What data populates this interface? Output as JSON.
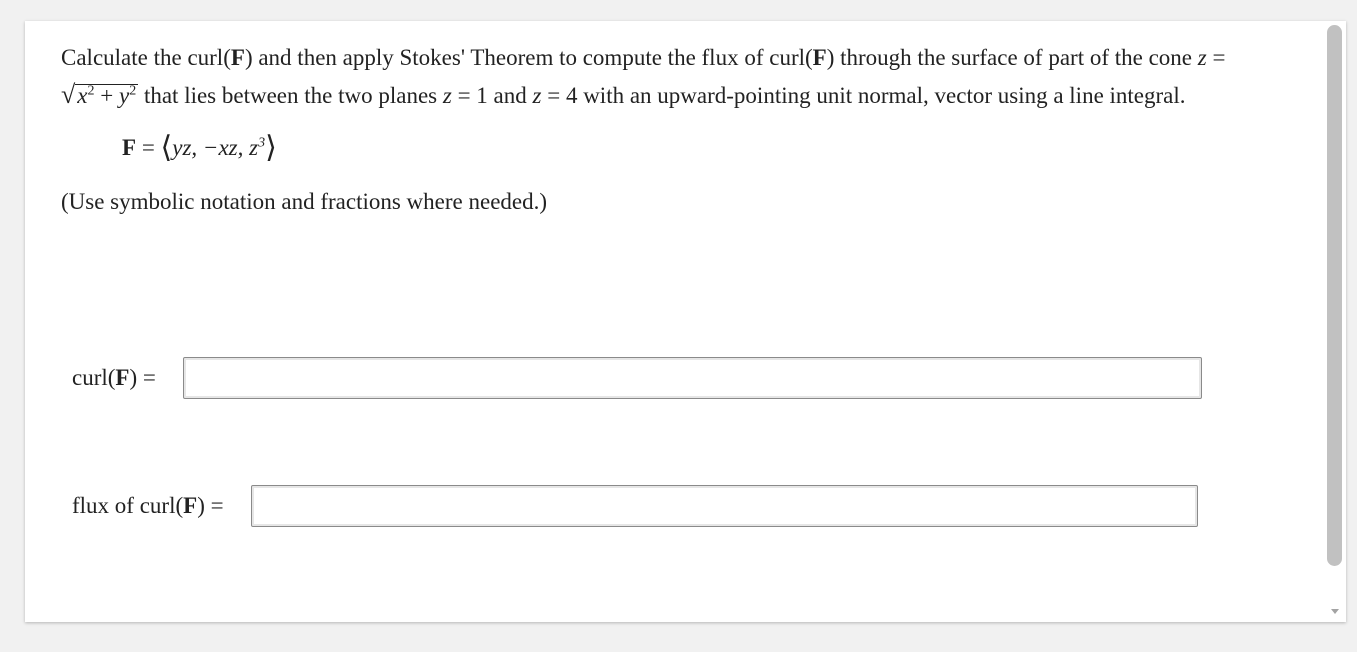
{
  "problem": {
    "p1": "Calculate the curl(",
    "F_bold": "F",
    "p2": ") and then apply Stokes' Theorem to compute the flux of curl(",
    "p3": ") through the surface of part of the cone ",
    "z_var": "z",
    "eq": " = ",
    "radicand_x": "x",
    "plus": " + ",
    "radicand_y": "y",
    "sq": "2",
    "p4": " that lies between the two planes ",
    "p5": " = 1 and ",
    "p6": " = 4 with an upward-pointing unit normal, vector using a line integral."
  },
  "formula": {
    "F": "F",
    "equals": " = ",
    "open": "⟨",
    "body": "yz, −xz, z",
    "power": "3",
    "close": "⟩"
  },
  "hint": "(Use symbolic notation and fractions where needed.)",
  "answers": {
    "curl_label_pre": "curl(",
    "curl_label_F": "F",
    "curl_label_post": ") =",
    "curl_value": "",
    "flux_label_pre": "flux of curl(",
    "flux_label_F": "F",
    "flux_label_post": ") =",
    "flux_value": ""
  },
  "icons": {
    "scroll_up": "chevron-up-icon",
    "scroll_down": "chevron-down-icon"
  }
}
